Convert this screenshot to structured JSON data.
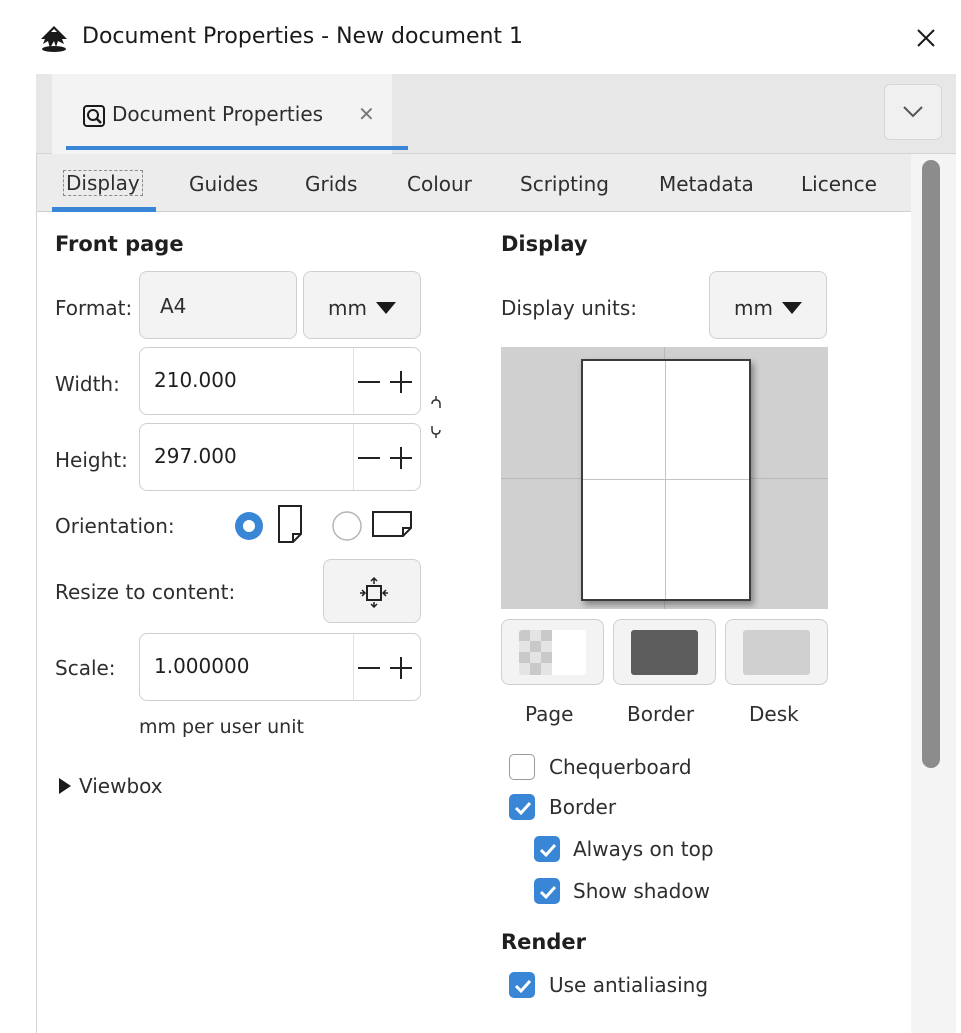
{
  "window": {
    "title": "Document Properties - New document 1",
    "close_glyph": "✕"
  },
  "dock": {
    "tab_label": "Document Properties",
    "tab_close_glyph": "✕",
    "accent_color": "#3a86d6"
  },
  "tabs": [
    {
      "label": "Display",
      "active": true
    },
    {
      "label": "Guides"
    },
    {
      "label": "Grids"
    },
    {
      "label": "Colour"
    },
    {
      "label": "Scripting"
    },
    {
      "label": "Metadata"
    },
    {
      "label": "Licence"
    }
  ],
  "front_page": {
    "title": "Front page",
    "format_label": "Format:",
    "format_value": "A4",
    "format_unit": "mm",
    "width_label": "Width:",
    "width_value": "210.000",
    "height_label": "Height:",
    "height_value": "297.000",
    "orientation_label": "Orientation:",
    "orientation_selected": "portrait",
    "resize_label": "Resize to content:",
    "scale_label": "Scale:",
    "scale_value": "1.000000",
    "scale_unit": "mm per user unit",
    "viewbox_label": "Viewbox"
  },
  "display": {
    "title": "Display",
    "units_label": "Display units:",
    "units_value": "mm",
    "page_label": "Page",
    "border_label": "Border",
    "desk_label": "Desk",
    "border_color": "#5d5d5d",
    "desk_color": "#d0d0d0",
    "chequerboard_label": "Chequerboard",
    "chequerboard_checked": false,
    "border_check_label": "Border",
    "border_checked": true,
    "always_on_top_label": "Always on top",
    "always_on_top_checked": true,
    "show_shadow_label": "Show shadow",
    "show_shadow_checked": true
  },
  "render": {
    "title": "Render",
    "antialiasing_label": "Use antialiasing",
    "antialiasing_checked": true
  }
}
